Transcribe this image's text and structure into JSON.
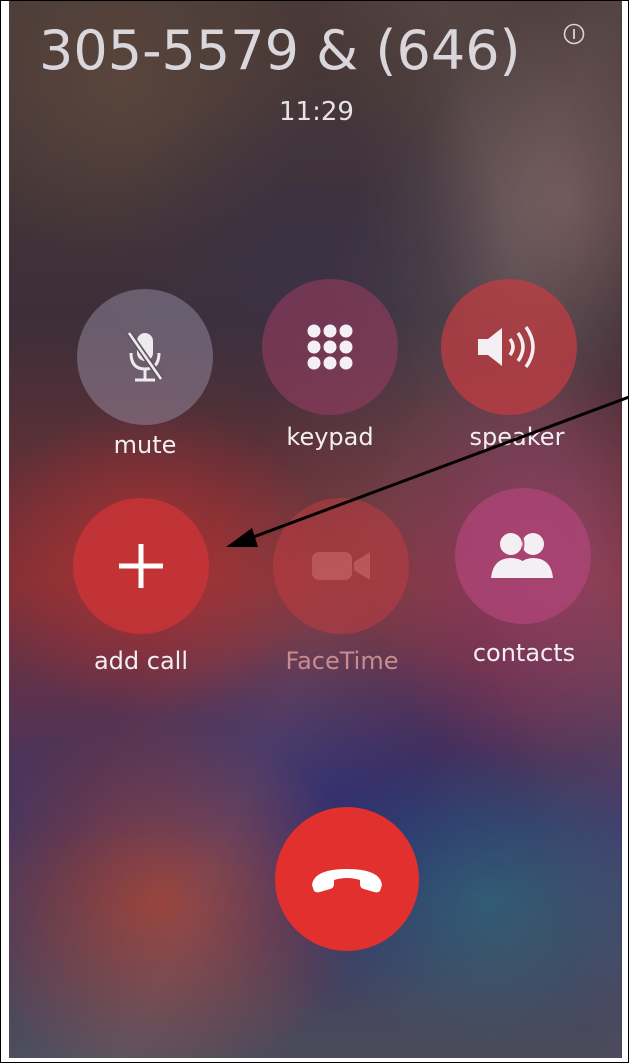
{
  "call": {
    "caller_display": "305-5579 & (646)",
    "timer": "11:29"
  },
  "controls": {
    "mute_label": "mute",
    "keypad_label": "keypad",
    "speaker_label": "speaker",
    "add_call_label": "add call",
    "facetime_label": "FaceTime",
    "contacts_label": "contacts"
  },
  "icons": {
    "info": "info-icon",
    "mute": "microphone-slash-icon",
    "keypad": "keypad-grid-icon",
    "speaker": "speaker-icon",
    "add_call": "plus-icon",
    "facetime": "video-camera-icon",
    "contacts": "contacts-icon",
    "end_call": "phone-hangup-icon"
  },
  "colors": {
    "end_call": "#e2302f",
    "button_tint": "#c0393d",
    "disabled_text": "#c98c8c"
  }
}
